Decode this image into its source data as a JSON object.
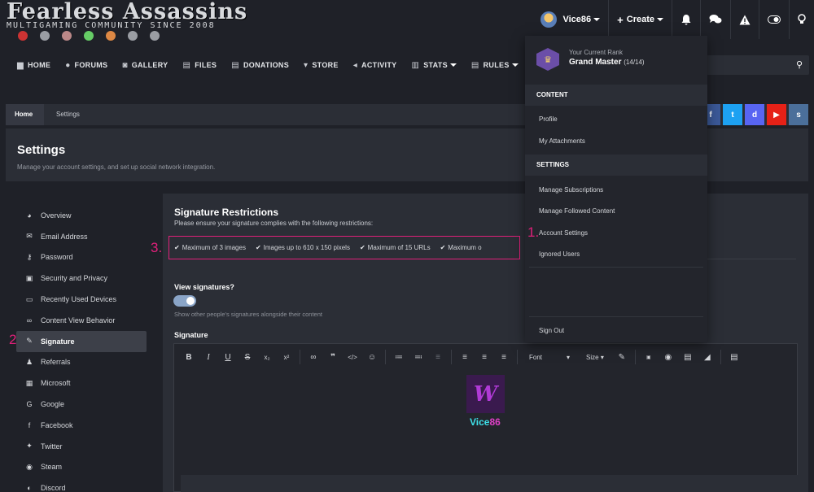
{
  "logo": {
    "title": "Fearless Assassins",
    "subtitle": "MULTIGAMING COMMUNITY SINCE 2008"
  },
  "user_bar": {
    "username": "Vice86",
    "create_label": "Create"
  },
  "nav": {
    "items": [
      "HOME",
      "FORUMS",
      "GALLERY",
      "FILES",
      "DONATIONS",
      "STORE",
      "ACTIVITY",
      "STATS",
      "RULES"
    ]
  },
  "breadcrumb": {
    "home": "Home",
    "current": "Settings"
  },
  "page": {
    "title": "Settings",
    "description": "Manage your account settings, and set up social network integration."
  },
  "sidebar": {
    "items": [
      "Overview",
      "Email Address",
      "Password",
      "Security and Privacy",
      "Recently Used Devices",
      "Content View Behavior",
      "Signature",
      "Referrals",
      "Microsoft",
      "Google",
      "Facebook",
      "Twitter",
      "Steam",
      "Discord"
    ]
  },
  "signature": {
    "title": "Signature Restrictions",
    "description": "Please ensure your signature complies with the following restrictions:",
    "restrictions": [
      "Maximum of 3 images",
      "Images up to 610 x 150 pixels",
      "Maximum of 15 URLs",
      "Maximum o"
    ],
    "view_label": "View signatures?",
    "view_desc": "Show other people's signatures alongside their content",
    "sig_label": "Signature",
    "toolbar": {
      "font": "Font",
      "size": "Size"
    },
    "sig_name_a": "Vice",
    "sig_name_b": "86"
  },
  "dropdown": {
    "rank_label": "Your Current Rank",
    "rank_value": "Grand Master",
    "rank_frac": "(14/14)",
    "content_head": "CONTENT",
    "content_items": [
      "Profile",
      "My Attachments"
    ],
    "settings_head": "SETTINGS",
    "settings_items": [
      "Manage Subscriptions",
      "Manage Followed Content",
      "Account Settings",
      "Ignored Users"
    ],
    "sign_out": "Sign Out"
  },
  "annotations": {
    "a1": "1.",
    "a2": "2",
    "a3": "3."
  },
  "colors": {
    "accent_pink": "#e0207a",
    "panel": "#2b2e36",
    "background": "#1f2128",
    "toggle": "#8aa5c8"
  }
}
